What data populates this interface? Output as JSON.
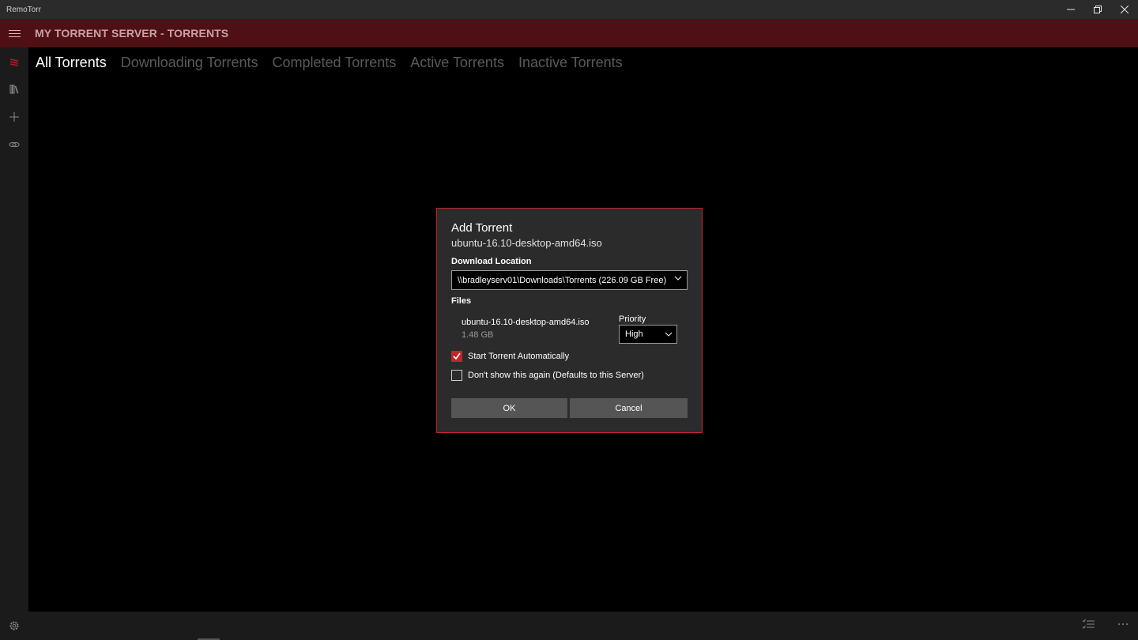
{
  "window": {
    "app_title": "RemoTorr",
    "controls": [
      "minimize",
      "restore",
      "close"
    ]
  },
  "header": {
    "title": "MY TORRENT SERVER - TORRENTS"
  },
  "nav": {
    "items": [
      {
        "icon": "torrents-icon",
        "active": true
      },
      {
        "icon": "library-icon",
        "active": false
      },
      {
        "icon": "add-icon",
        "active": false
      },
      {
        "icon": "link-icon",
        "active": false
      }
    ],
    "settings_icon": "gear-icon"
  },
  "tabs": [
    {
      "label": "All Torrents",
      "active": true
    },
    {
      "label": "Downloading Torrents",
      "active": false
    },
    {
      "label": "Completed Torrents",
      "active": false
    },
    {
      "label": "Active Torrents",
      "active": false
    },
    {
      "label": "Inactive Torrents",
      "active": false
    }
  ],
  "dialog": {
    "title": "Add Torrent",
    "subtitle": "ubuntu-16.10-desktop-amd64.iso",
    "download_location_label": "Download Location",
    "download_location_value": "\\\\bradleyserv01\\Downloads\\Torrents (226.09 GB Free)",
    "files_label": "Files",
    "file": {
      "name": "ubuntu-16.10-desktop-amd64.iso",
      "size": "1.48 GB",
      "priority_label": "Priority",
      "priority_value": "High"
    },
    "start_auto": {
      "label": "Start Torrent Automatically",
      "checked": true
    },
    "dont_show": {
      "label": "Don't show this again (Defaults to this Server)",
      "checked": false
    },
    "ok_label": "OK",
    "cancel_label": "Cancel"
  },
  "colors": {
    "accent": "#c2242b",
    "header_bg": "#4e1014",
    "dialog_bg": "#2b2b2b"
  }
}
